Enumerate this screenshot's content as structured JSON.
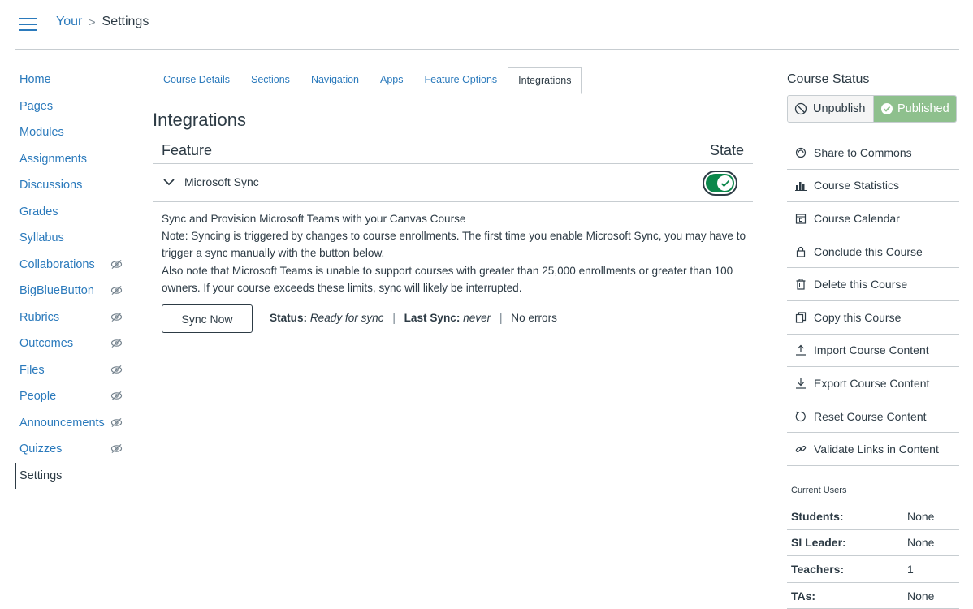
{
  "header": {
    "breadcrumb_course": "Your",
    "breadcrumb_separator": ">",
    "breadcrumb_current": "Settings",
    "accent_color": "#2b7abc"
  },
  "nav": {
    "items": [
      {
        "label": "Home",
        "hidden": false
      },
      {
        "label": "Pages",
        "hidden": false
      },
      {
        "label": "Modules",
        "hidden": false
      },
      {
        "label": "Assignments",
        "hidden": false
      },
      {
        "label": "Discussions",
        "hidden": false
      },
      {
        "label": "Grades",
        "hidden": false
      },
      {
        "label": "Syllabus",
        "hidden": false
      },
      {
        "label": "Collaborations",
        "hidden": true
      },
      {
        "label": "BigBlueButton",
        "hidden": true
      },
      {
        "label": "Rubrics",
        "hidden": true
      },
      {
        "label": "Outcomes",
        "hidden": true
      },
      {
        "label": "Files",
        "hidden": true
      },
      {
        "label": "People",
        "hidden": true
      },
      {
        "label": "Announcements",
        "hidden": true
      },
      {
        "label": "Quizzes",
        "hidden": true
      },
      {
        "label": "Settings",
        "hidden": false,
        "active": true
      }
    ]
  },
  "tabs": [
    {
      "label": "Course Details"
    },
    {
      "label": "Sections"
    },
    {
      "label": "Navigation"
    },
    {
      "label": "Apps"
    },
    {
      "label": "Feature Options"
    },
    {
      "label": "Integrations",
      "active": true
    }
  ],
  "main": {
    "title": "Integrations",
    "col_feature": "Feature",
    "col_state": "State",
    "feature_name": "Microsoft Sync",
    "toggle_on": true,
    "toggle_color": "#0b874b",
    "desc_line1": "Sync and Provision Microsoft Teams with your Canvas Course",
    "desc_line2": "Note: Syncing is triggered by changes to course enrollments. The first time you enable Microsoft Sync, you may have to trigger a sync manually with the button below.",
    "desc_line3": "Also note that Microsoft Teams is unable to support courses with greater than 25,000 enrollments or greater than 100 owners. If your course exceeds these limits, sync will likely be interrupted.",
    "sync_button": "Sync Now",
    "status_label": "Status:",
    "status_value": "Ready for sync",
    "separator": "|",
    "last_sync_label": "Last Sync:",
    "last_sync_value": "never",
    "errors_text": "No errors"
  },
  "sidebar": {
    "course_status_title": "Course Status",
    "unpublish_label": "Unpublish",
    "published_label": "Published",
    "published_color": "#8ec08d",
    "actions": [
      {
        "label": "Share to Commons",
        "icon": "commons-icon"
      },
      {
        "label": "Course Statistics",
        "icon": "statistics-icon"
      },
      {
        "label": "Course Calendar",
        "icon": "calendar-icon"
      },
      {
        "label": "Conclude this Course",
        "icon": "lock-icon"
      },
      {
        "label": "Delete this Course",
        "icon": "trash-icon"
      },
      {
        "label": "Copy this Course",
        "icon": "copy-icon"
      },
      {
        "label": "Import Course Content",
        "icon": "upload-icon"
      },
      {
        "label": "Export Course Content",
        "icon": "download-icon"
      },
      {
        "label": "Reset Course Content",
        "icon": "reset-icon"
      },
      {
        "label": "Validate Links in Content",
        "icon": "link-icon"
      }
    ],
    "current_users_title": "Current Users",
    "users": [
      {
        "label": "Students:",
        "value": "None"
      },
      {
        "label": "SI Leader:",
        "value": "None"
      },
      {
        "label": "Teachers:",
        "value": "1"
      },
      {
        "label": "TAs:",
        "value": "None"
      }
    ]
  }
}
